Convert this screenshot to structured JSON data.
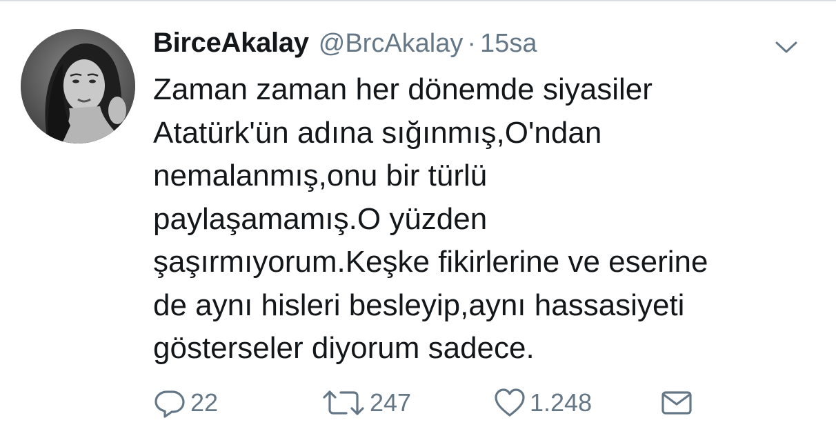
{
  "tweet": {
    "display_name": "BirceAkalay",
    "handle": "@BrcAkalay",
    "separator": "·",
    "timestamp": "15sa",
    "text_lines": [
      "Zaman zaman her dönemde siyasiler",
      "Atatürk'ün adına sığınmış,O'ndan",
      "nemalanmış,onu bir türlü",
      "paylaşamamış.O yüzden",
      "şaşırmıyorum.Keşke fikirlerine ve eserine",
      "de aynı hisleri besleyip,aynı hassasiyeti",
      "gösterseler diyorum sadece."
    ],
    "actions": {
      "reply": {
        "icon": "reply-icon",
        "count": "22"
      },
      "retweet": {
        "icon": "retweet-icon",
        "count": "247"
      },
      "like": {
        "icon": "heart-icon",
        "count": "1.248"
      },
      "message": {
        "icon": "envelope-icon"
      }
    },
    "menu_icon": "chevron-down-icon"
  },
  "colors": {
    "text_primary": "#14171a",
    "text_secondary": "#657786",
    "divider": "#d9dde1",
    "background": "#ffffff"
  }
}
